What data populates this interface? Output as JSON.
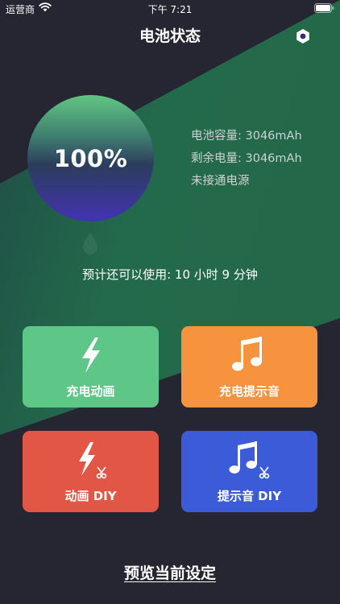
{
  "status_bar": {
    "carrier": "运营商",
    "time": "下午 7:21",
    "icons": [
      "wifi-icon",
      "battery-icon"
    ]
  },
  "header": {
    "title": "电池状态",
    "settings_icon": "hexagon-gear-icon"
  },
  "battery": {
    "percent_text": "100%",
    "level": 1.0,
    "capacity": "电池容量: 3046mAh",
    "remaining": "剩余电量: 3046mAh",
    "power_status": "未接通电源"
  },
  "estimate": {
    "text": "预计还可以使用:  10 小时 9 分钟"
  },
  "tiles": [
    {
      "label": "充电动画",
      "icon": "lightning-icon",
      "color": "#5ec787"
    },
    {
      "label": "充电提示音",
      "icon": "music-note-icon",
      "color": "#f7923f"
    },
    {
      "label": "动画 DIY",
      "icon": "lightning-scissors-icon",
      "color": "#e15645"
    },
    {
      "label": "提示音 DIY",
      "icon": "music-note-scissors-icon",
      "color": "#3c5bd9"
    }
  ],
  "footer": {
    "preview_label": "预览当前设定"
  },
  "colors": {
    "background": "#262532",
    "accent_band": "#226a4a"
  }
}
